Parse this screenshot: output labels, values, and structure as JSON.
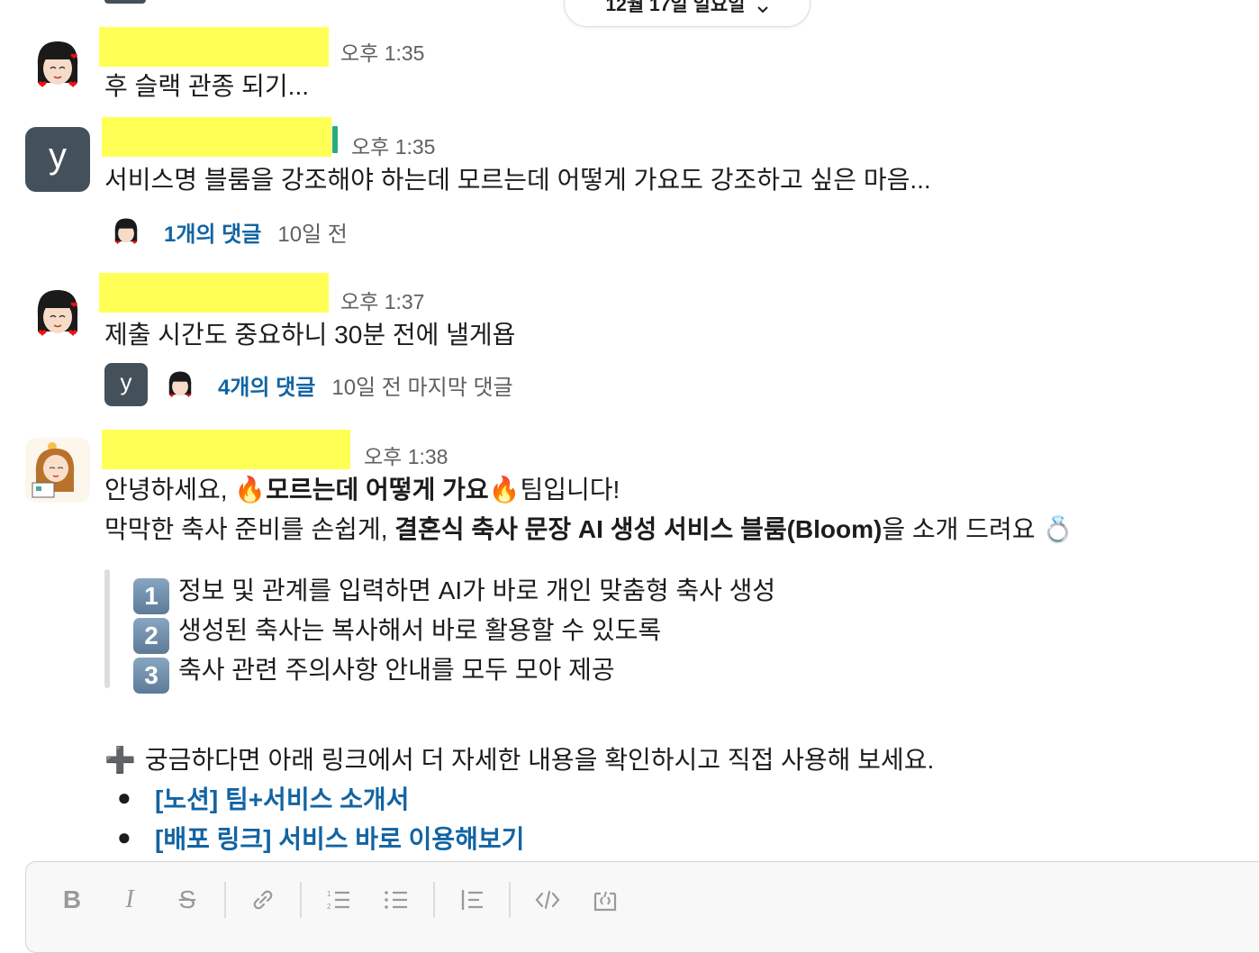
{
  "date_divider": {
    "label": "12월 17일 일요일",
    "chevron": "chevron-down-icon"
  },
  "messages": [
    {
      "time": "오후 1:35",
      "text": "후 슬랙 관종 되기..."
    },
    {
      "avatar_letter": "y",
      "time": "오후 1:35",
      "text": "서비스명 블룸을 강조해야 하는데 모르는데 어떻게 가요도 강조하고 싶은 마음...",
      "thread": {
        "reply_count": "1개의 댓글",
        "meta": "10일 전"
      }
    },
    {
      "time": "오후 1:37",
      "text": "제출 시간도 중요하니 30분 전에 낼게욥",
      "thread": {
        "avatar_letter": "y",
        "reply_count": "4개의 댓글",
        "meta": "10일 전 마지막 댓글"
      }
    },
    {
      "time": "오후 1:38",
      "line1_pre": "안녕하세요, ",
      "line1_fire": "🔥",
      "line1_bold": "모르는데 어떻게 가요",
      "line1_post": "팀입니다!",
      "line2_pre": "막막한 축사 준비를 손쉽게, ",
      "line2_bold": "결혼식 축사 문장 AI 생성 서비스 블룸(Bloom)",
      "line2_post": "을 소개 드려요 ",
      "line2_emoji": "💍",
      "quote": [
        {
          "num": "1",
          "text": "정보 및 관계를 입력하면 AI가 바로 개인 맞춤형 축사 생성"
        },
        {
          "num": "2",
          "text": "생성된 축사는 복사해서 바로 활용할 수 있도록"
        },
        {
          "num": "3",
          "text": "축사 관련 주의사항 안내를 모두 모아 제공"
        }
      ],
      "plus_icon": "➕",
      "footer": "궁금하다면 아래 링크에서 더 자세한 내용을 확인하시고 직접 사용해 보세요.",
      "links": [
        "[노션] 팀+서비스 소개서",
        "[배포 링크] 서비스 바로 이용해보기"
      ]
    }
  ],
  "composer": {
    "toolbar": [
      "B",
      "I",
      "S",
      "link-icon",
      "ordered-list-icon",
      "bulleted-list-icon",
      "blockquote-icon",
      "code-icon",
      "code-block-icon"
    ]
  }
}
